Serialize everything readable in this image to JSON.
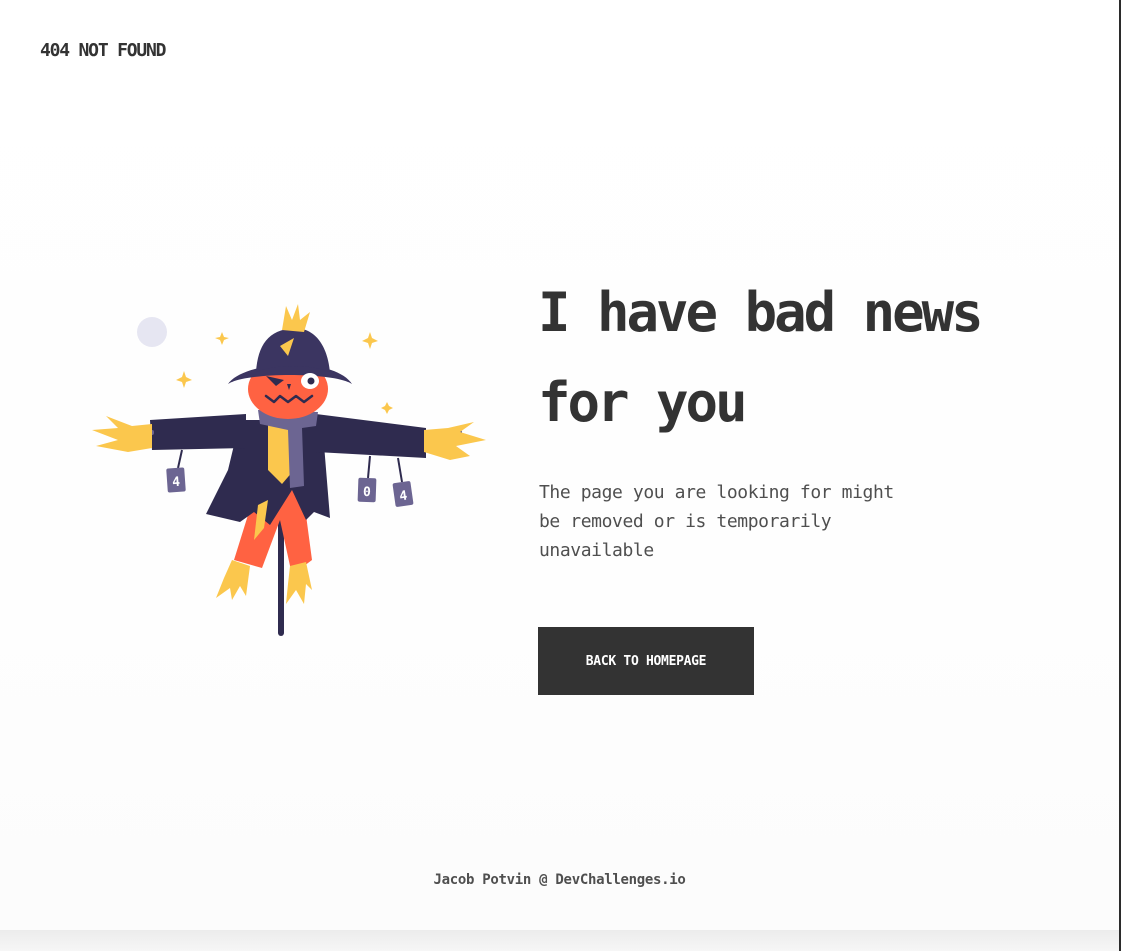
{
  "header": {
    "logo_text": "404 NOT FOUND"
  },
  "illustration": {
    "name": "scarecrow",
    "sign_digits": [
      "4",
      "0",
      "4"
    ],
    "colors": {
      "hat": "#3b3561",
      "coat": "#2f2b4f",
      "face": "#ff6242",
      "straw": "#fbc74d",
      "scarf": "#6c6592",
      "moon": "#e6e6f2"
    }
  },
  "main": {
    "headline": "I have bad news for you",
    "description": "The page you are looking for might be removed or is temporarily unavailable",
    "button_label": "BACK TO HOMEPAGE"
  },
  "footer": {
    "credit": "Jacob Potvin @ DevChallenges.io"
  },
  "colors": {
    "text": "#333333",
    "button_bg": "#333333",
    "button_text": "#ffffff"
  }
}
